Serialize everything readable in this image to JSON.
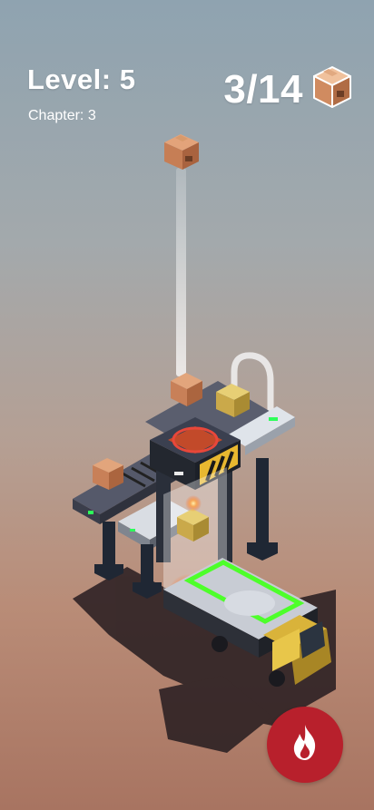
{
  "hud": {
    "level_text": "Level: 5",
    "chapter_text": "Chapter: 3",
    "boxes_counter": "3/14"
  },
  "icons": {
    "counter_icon": "cardboard-box-icon",
    "action_button_icon": "fire-icon"
  },
  "colors": {
    "hud_text": "#ffffff",
    "fire_button": "#b8202c",
    "box": "#c9825a",
    "hazard_yellow": "#e8b830",
    "truck_zone_green": "#4dff2a",
    "truck_body": "#d9b33a"
  }
}
